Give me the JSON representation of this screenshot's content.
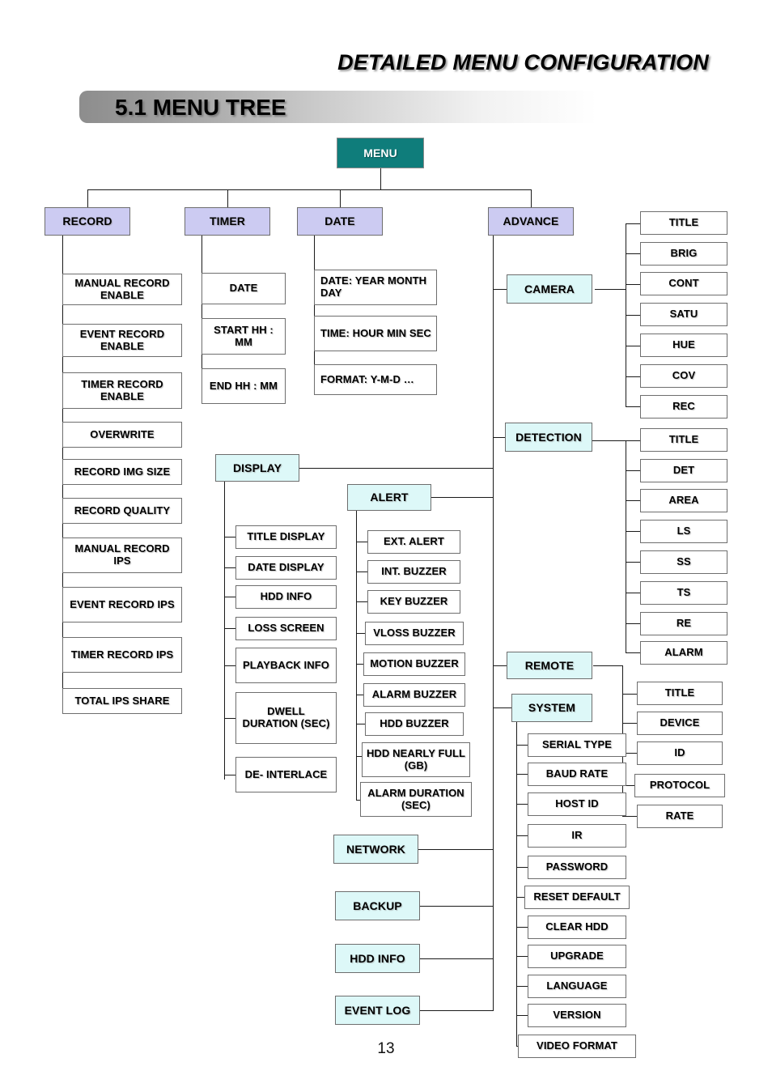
{
  "header": {
    "doc_title": "DETAILED MENU CONFIGURATION",
    "section_title": "5.1 MENU TREE"
  },
  "page_number": "13",
  "colors": {
    "root_box": "#0f7d7b",
    "level1_box": "#cccbf2",
    "level2_box": "#ddf8f8",
    "leaf_box": "#ffffff",
    "border": "#6e6e6e",
    "line": "#1a1a1a",
    "bar_gradient_start": "#8d8d8d",
    "bar_gradient_end": "#ffffff"
  },
  "tree": {
    "root": {
      "label": "MENU"
    },
    "record": {
      "label": "RECORD",
      "items": [
        "MANUAL RECORD ENABLE",
        "EVENT RECORD ENABLE",
        "TIMER RECORD ENABLE",
        "OVERWRITE",
        "RECORD IMG SIZE",
        "RECORD QUALITY",
        "MANUAL RECORD IPS",
        "EVENT RECORD IPS",
        "TIMER RECORD IPS",
        "TOTAL IPS SHARE"
      ]
    },
    "timer": {
      "label": "TIMER",
      "items": [
        "DATE",
        "START HH : MM",
        "END HH : MM"
      ]
    },
    "date": {
      "label": "DATE",
      "items": [
        "DATE: YEAR MONTH DAY",
        "TIME: HOUR MIN SEC",
        "FORMAT: Y-M-D …"
      ]
    },
    "advance": {
      "label": "ADVANCE",
      "groups": [
        {
          "label": "CAMERA",
          "items": [
            "TITLE",
            "BRIG",
            "CONT",
            "SATU",
            "HUE",
            "COV",
            "REC"
          ]
        },
        {
          "label": "DETECTION",
          "items": [
            "TITLE",
            "DET",
            "AREA",
            "LS",
            "SS",
            "TS",
            "RE",
            "ALARM"
          ]
        },
        {
          "label": "DISPLAY",
          "items": [
            "TITLE DISPLAY",
            "DATE DISPLAY",
            "HDD INFO",
            "LOSS SCREEN",
            "PLAYBACK INFO",
            "DWELL DURATION (SEC)",
            "DE- INTERLACE"
          ]
        },
        {
          "label": "ALERT",
          "items": [
            "EXT. ALERT",
            "INT. BUZZER",
            "KEY BUZZER",
            "VLOSS BUZZER",
            "MOTION BUZZER",
            "ALARM BUZZER",
            "HDD BUZZER",
            "HDD NEARLY FULL (GB)",
            "ALARM DURATION (SEC)"
          ]
        },
        {
          "label": "REMOTE",
          "items": [
            "TITLE",
            "DEVICE",
            "ID",
            "PROTOCOL",
            "RATE"
          ]
        },
        {
          "label": "SYSTEM",
          "items": [
            "SERIAL TYPE",
            "BAUD RATE",
            "HOST ID",
            "IR",
            "PASSWORD",
            "RESET DEFAULT",
            "CLEAR HDD",
            "UPGRADE",
            "LANGUAGE",
            "VERSION",
            "VIDEO FORMAT"
          ]
        },
        {
          "label": "NETWORK",
          "items": []
        },
        {
          "label": "BACKUP",
          "items": []
        },
        {
          "label": "HDD INFO",
          "items": []
        },
        {
          "label": "EVENT LOG",
          "items": []
        }
      ]
    }
  }
}
